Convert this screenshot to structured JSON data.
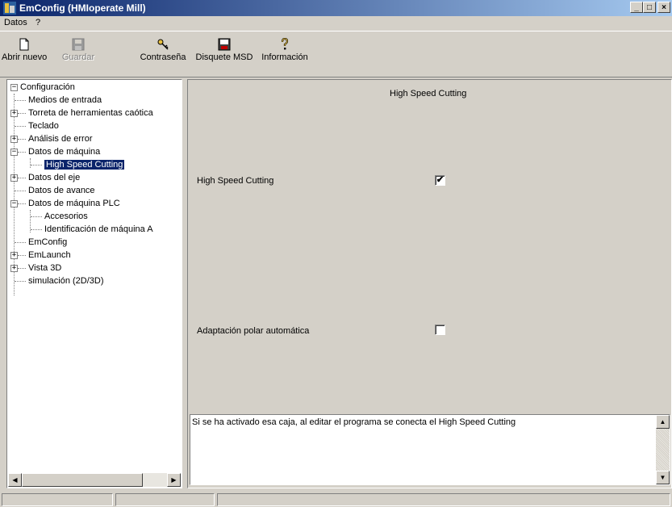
{
  "window": {
    "title": "EmConfig (HMIoperate Mill)",
    "minimize": "_",
    "maximize": "□",
    "close": "×"
  },
  "menu": {
    "items": [
      "Datos",
      "?"
    ]
  },
  "toolbar": {
    "buttons": [
      {
        "label": "Abrir nuevo",
        "icon": "new-document-icon",
        "enabled": true
      },
      {
        "label": "Guardar",
        "icon": "save-disk-icon",
        "enabled": false
      },
      {
        "label": "Contraseña",
        "icon": "keys-icon",
        "enabled": true
      },
      {
        "label": "Disquete MSD",
        "icon": "msd-disk-icon",
        "enabled": true
      },
      {
        "label": "Información",
        "icon": "info-icon",
        "enabled": true
      }
    ]
  },
  "tree": {
    "items": [
      {
        "label": "Configuración",
        "expander": "minus"
      },
      {
        "label": "Medios de entrada",
        "expander": ""
      },
      {
        "label": "Torreta de herramientas caótica",
        "expander": "plus"
      },
      {
        "label": "Teclado",
        "expander": ""
      },
      {
        "label": "Análisis de error",
        "expander": "plus"
      },
      {
        "label": "Datos de máquina",
        "expander": "minus"
      },
      {
        "label": "High Speed Cutting",
        "expander": "",
        "selected": true
      },
      {
        "label": "Datos del eje",
        "expander": "plus"
      },
      {
        "label": "Datos de avance",
        "expander": ""
      },
      {
        "label": "Datos de máquina PLC",
        "expander": "minus"
      },
      {
        "label": "Accesorios",
        "expander": ""
      },
      {
        "label": "Identificación de máquina A",
        "expander": ""
      },
      {
        "label": "EmConfig",
        "expander": ""
      },
      {
        "label": "EmLaunch",
        "expander": "plus"
      },
      {
        "label": "Vista 3D",
        "expander": "plus"
      },
      {
        "label": "simulación (2D/3D)",
        "expander": ""
      }
    ]
  },
  "main": {
    "heading": "High Speed Cutting",
    "options": [
      {
        "label": "High Speed Cutting",
        "checked": true
      },
      {
        "label": "Adaptación polar automática",
        "checked": false
      }
    ],
    "description": "Si se ha activado esa caja, al editar el programa se conecta el High Speed Cutting"
  },
  "glyphs": {
    "check": "✔",
    "left": "◀",
    "right": "▶",
    "up": "▲",
    "down": "▼",
    "plus": "+",
    "minus": "−"
  }
}
